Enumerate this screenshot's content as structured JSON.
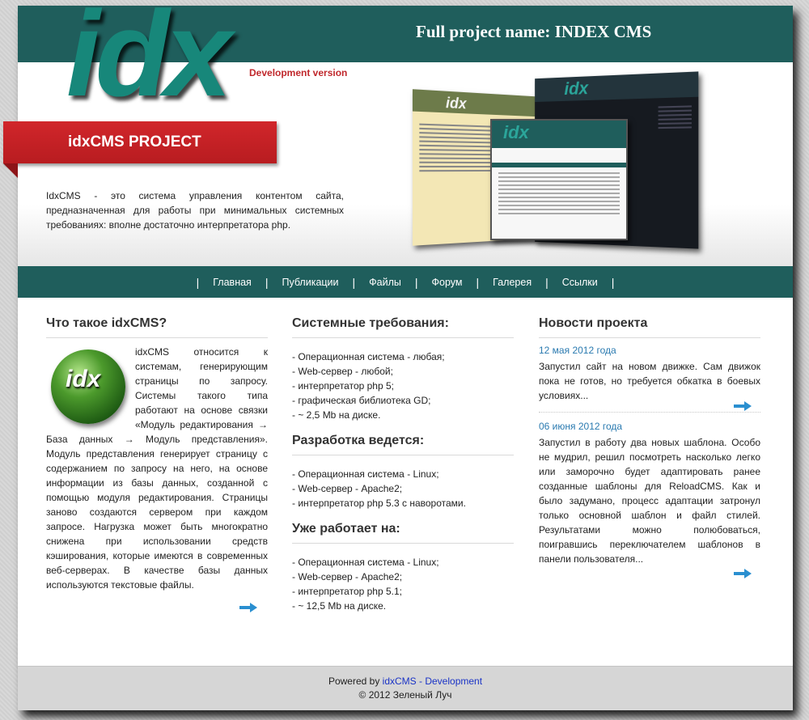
{
  "header": {
    "project_name": "Full project name: INDEX CMS",
    "logo": "idx",
    "dev_version": "Development version",
    "ribbon_label": "idxCMS PROJECT",
    "intro": "IdxCMS - это система управления контентом сайта, предназначенная для работы при минимальных системных требованиях: вполне достаточно интерпретатора php.",
    "collage_logo": "idx"
  },
  "nav": {
    "items": [
      "Главная",
      "Публикации",
      "Файлы",
      "Форум",
      "Галерея",
      "Ссылки"
    ]
  },
  "about": {
    "title": "Что такое idxCMS?",
    "ball_text": "idx",
    "text": "idxCMS относится к системам, генерирующим страницы по запросу. Системы такого типа работают на основе связки «Модуль редактирования → База данных → Модуль представления». Модуль представления генерирует страницу с содержанием по запросу на него, на основе информации из базы данных, созданной с помощью модуля редактирования. Страницы заново создаются сервером при каждом запросе. Нагрузка может быть многократно снижена при использовании средств кэширования, которые имеются в современных веб-серверах. В качестве базы данных используются текстовые файлы."
  },
  "requirements": {
    "title": "Системные требования:",
    "items": [
      "- Операционная система - любая;",
      "- Web-сервер - любой;",
      "- интерпретатор php 5;",
      "- графическая библиотека GD;",
      "- ~ 2,5 Mb на диске."
    ],
    "dev_title": "Разработка ведется:",
    "dev_items": [
      "- Операционная система - Linux;",
      "- Web-сервер - Apache2;",
      "- интерпретатор php 5.3 с наворотами."
    ],
    "works_title": "Уже работает на:",
    "works_items": [
      "- Операционная система - Linux;",
      "- Web-сервер - Apache2;",
      "- интерпретатор php 5.1;",
      "- ~ 12,5 Mb на диске."
    ]
  },
  "news": {
    "title": "Новости проекта",
    "items": [
      {
        "date": "12 мая 2012 года",
        "text": "Запустил сайт на новом движке. Сам движок пока не готов, но требуется обкатка в боевых условиях..."
      },
      {
        "date": "06 июня 2012 года",
        "text": "Запустил в работу два новых шаблона. Особо не мудрил, решил посмотреть насколько легко или заморочно будет адаптировать ранее созданные шаблоны для ReloadCMS. Как и было задумано, процесс адаптации затронул только основной шаблон и файл стилей. Результатами можно полюбоваться, поигравшись переключателем шаблонов в панели пользователя..."
      }
    ]
  },
  "footer": {
    "powered_by": "Powered by",
    "link": "idxCMS - Development",
    "copyright": "© 2012 Зеленый Луч"
  },
  "colors": {
    "header_bg": "#1f5e5c",
    "logo": "#17877a",
    "ribbon": "#d1262b",
    "link": "#2a7ab0"
  }
}
